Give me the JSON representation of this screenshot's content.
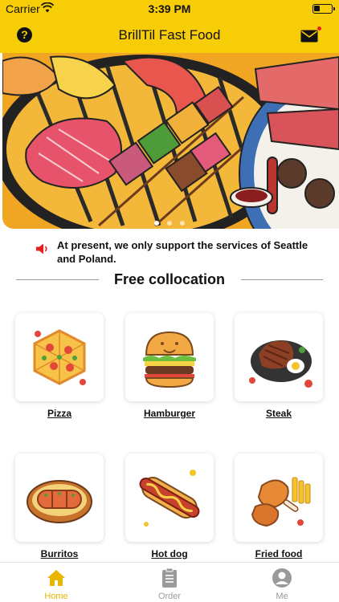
{
  "status_bar": {
    "carrier": "Carrier",
    "time": "3:39 PM"
  },
  "header": {
    "title": "BrillTil Fast Food",
    "help_icon": "?"
  },
  "banner": {
    "image": "grilled-bbq-illustration",
    "slide_count": 3,
    "active_slide": 1
  },
  "notice": {
    "text": "At present, we only support the services of Seattle and Poland."
  },
  "section": {
    "title": "Free collocation"
  },
  "menu_items": [
    {
      "label": "Pizza",
      "icon": "pizza-icon"
    },
    {
      "label": "Hamburger",
      "icon": "hamburger-icon"
    },
    {
      "label": "Steak",
      "icon": "steak-icon"
    },
    {
      "label": "Burritos",
      "icon": "burritos-icon"
    },
    {
      "label": "Hot dog",
      "icon": "hotdog-icon"
    },
    {
      "label": "Fried food",
      "icon": "fried-food-icon"
    }
  ],
  "tabs": [
    {
      "label": "Home",
      "icon": "home-icon",
      "active": true
    },
    {
      "label": "Order",
      "icon": "clipboard-icon",
      "active": false
    },
    {
      "label": "Me",
      "icon": "user-icon",
      "active": false
    }
  ],
  "colors": {
    "brand": "#f7cd08",
    "active_tab": "#e8b500",
    "inactive_tab": "#9a9a9a",
    "notice_icon": "#e8201b"
  }
}
